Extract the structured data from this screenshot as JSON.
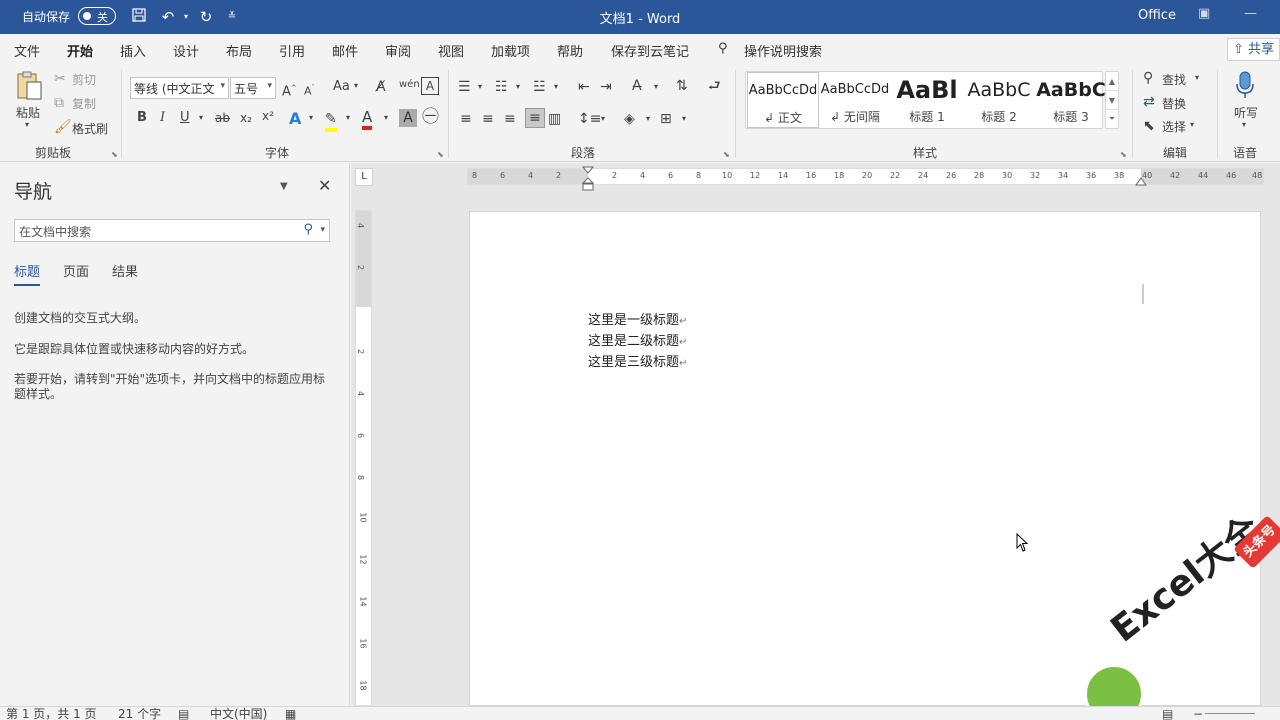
{
  "titlebar": {
    "autosave_label": "自动保存",
    "autosave_state": "关",
    "doc_title": "文档1  -  Word",
    "account": "Office"
  },
  "tabs": [
    "文件",
    "开始",
    "插入",
    "设计",
    "布局",
    "引用",
    "邮件",
    "审阅",
    "视图",
    "加载项",
    "帮助",
    "保存到云笔记"
  ],
  "active_tab": "开始",
  "tell_me": "操作说明搜索",
  "share": "共享",
  "ribbon": {
    "clipboard": {
      "paste": "粘贴",
      "cut": "剪切",
      "copy": "复制",
      "format_painter": "格式刷",
      "label": "剪贴板"
    },
    "font": {
      "font_name": "等线 (中文正文",
      "font_size": "五号",
      "label": "字体",
      "change_case": "Aa",
      "bold": "B",
      "italic": "I",
      "underline": "U",
      "strike": "ab",
      "sub": "x₂",
      "sup": "x²",
      "font_color_letter": "A"
    },
    "paragraph": {
      "label": "段落"
    },
    "styles": {
      "label": "样式",
      "items": [
        {
          "sample": "AaBbCcDd",
          "name": "正文"
        },
        {
          "sample": "AaBbCcDd",
          "name": "无间隔"
        },
        {
          "sample": "AaBl",
          "name": "标题 1"
        },
        {
          "sample": "AaBbC",
          "name": "标题 2"
        },
        {
          "sample": "AaBbC",
          "name": "标题 3"
        }
      ]
    },
    "editing": {
      "find": "查找",
      "replace": "替换",
      "select": "选择",
      "label": "编辑"
    },
    "voice": {
      "dictate": "听写",
      "label": "语音"
    }
  },
  "nav": {
    "title": "导航",
    "search_placeholder": "在文档中搜索",
    "tabs": [
      "标题",
      "页面",
      "结果"
    ],
    "active_tab": "标题",
    "text1": "创建文档的交互式大纲。",
    "text2": "它是跟踪具体位置或快速移动内容的好方式。",
    "text3": "若要开始，请转到\"开始\"选项卡，并向文档中的标题应用标题样式。"
  },
  "ruler": {
    "h_left": [
      "8",
      "6",
      "4",
      "2"
    ],
    "h_right": [
      "2",
      "4",
      "6",
      "8",
      "10",
      "12",
      "14",
      "16",
      "18",
      "20",
      "22",
      "24",
      "26",
      "28",
      "30",
      "32",
      "34",
      "36",
      "38",
      "40",
      "42",
      "44",
      "46",
      "48"
    ],
    "v_top": [
      "4",
      "2"
    ],
    "v_main": [
      "2",
      "4",
      "6",
      "8",
      "10",
      "12",
      "14",
      "16",
      "18"
    ]
  },
  "document": {
    "lines": [
      "这里是一级标题",
      "这里是二级标题",
      "这里是三级标题"
    ],
    "para_mark": "↵"
  },
  "status": {
    "page": "第 1 页，共 1 页",
    "words": "21 个字",
    "language": "中文(中国)"
  },
  "watermark": {
    "text": "Excel大全",
    "badge": "头条号"
  },
  "colors": {
    "accent": "#2b579a",
    "highlight": "#ffff00",
    "font_color": "#e02020"
  }
}
